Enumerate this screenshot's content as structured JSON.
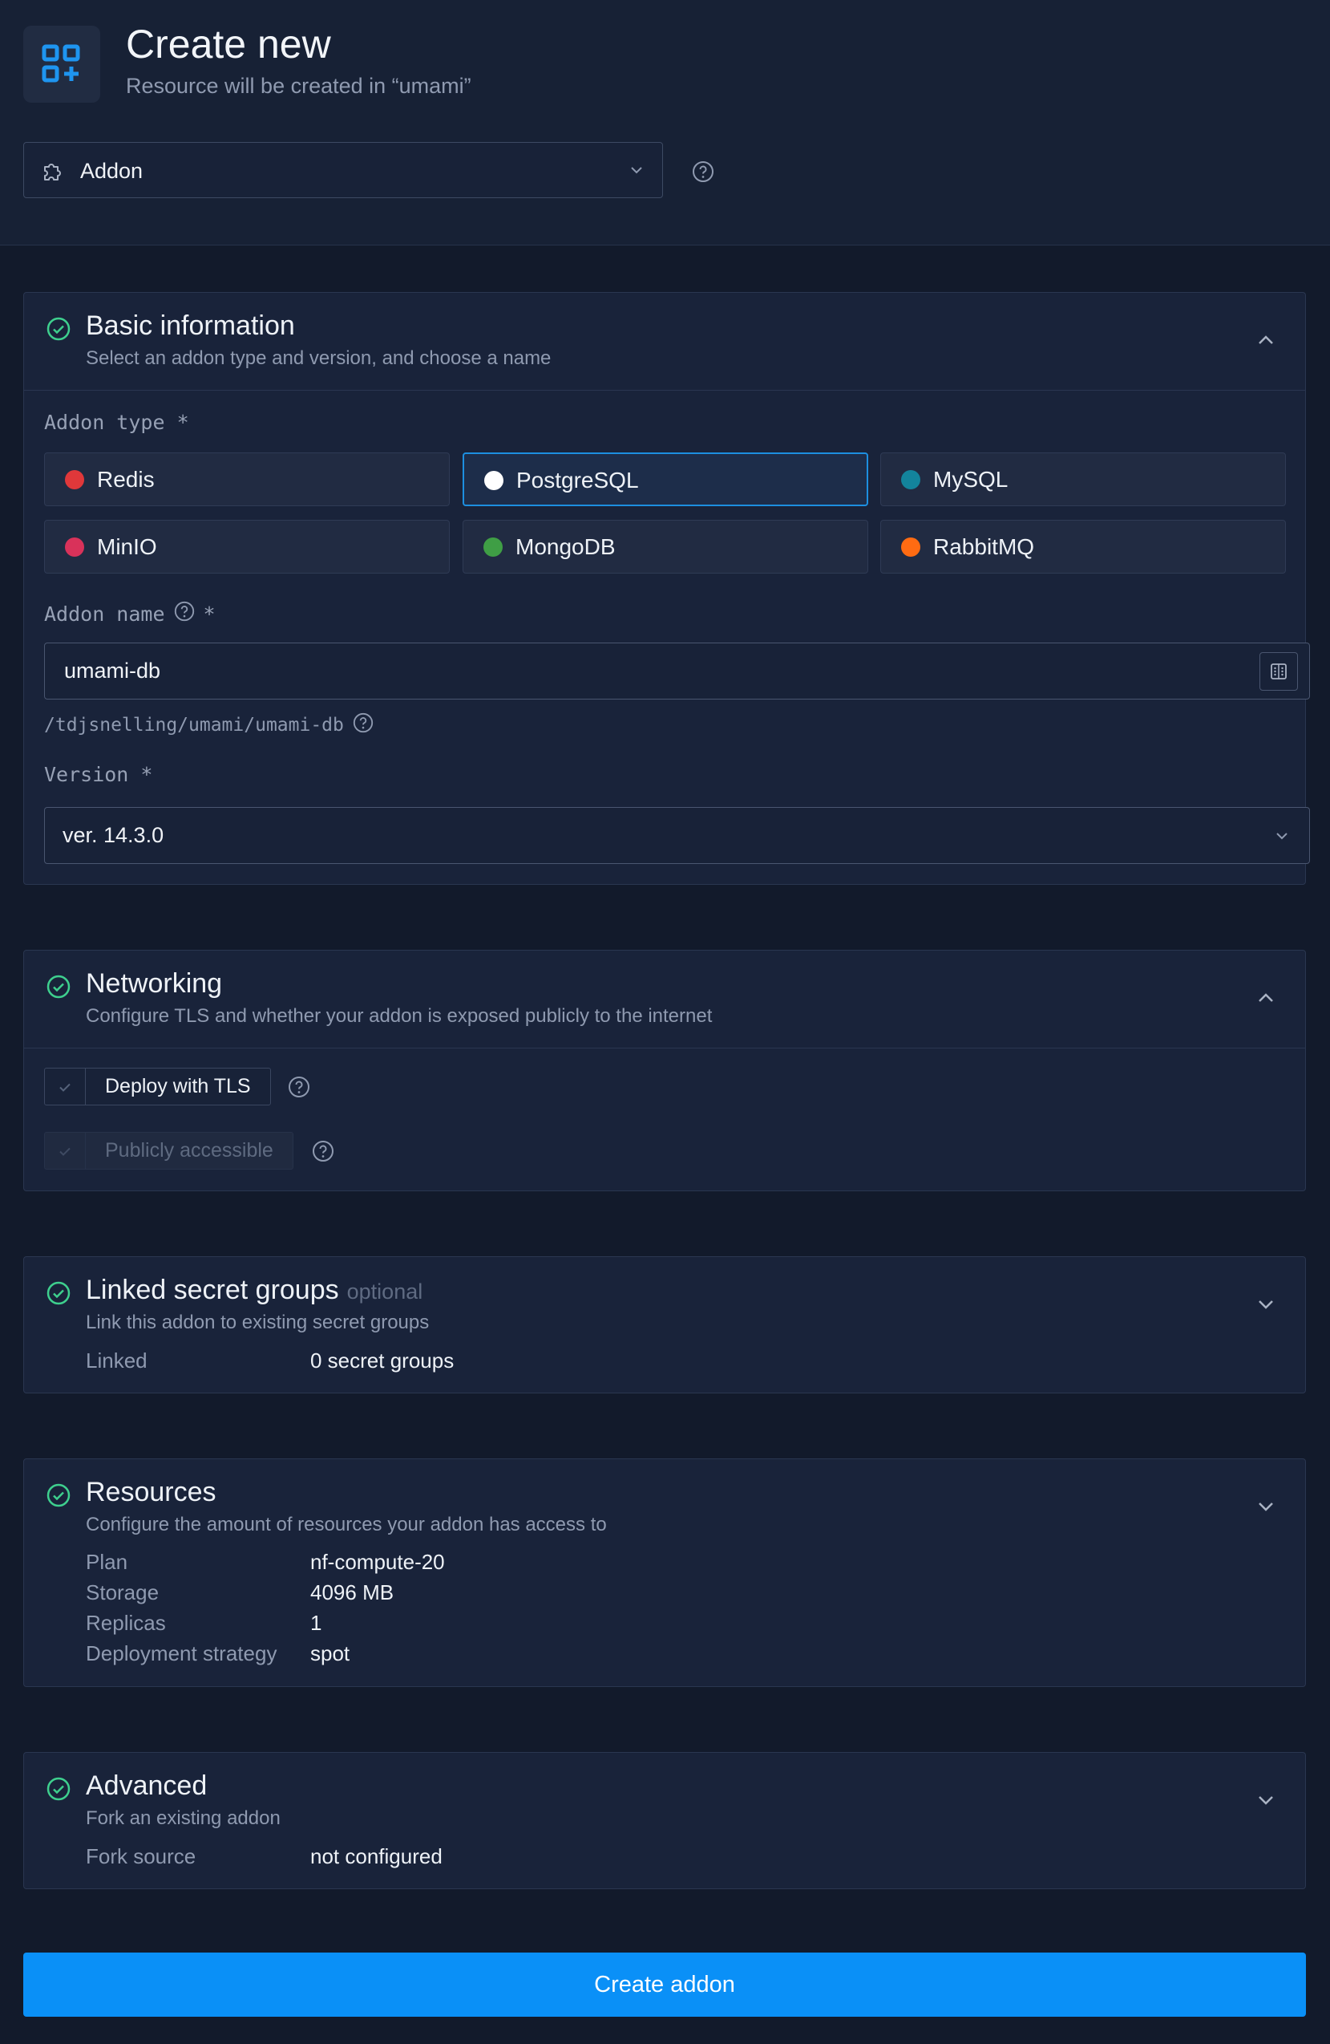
{
  "header": {
    "title": "Create new",
    "subtitle": "Resource will be created in “umami”",
    "icon": "add-grid-icon",
    "resource_type": {
      "label": "Addon",
      "icon": "puzzle-icon"
    }
  },
  "colors": {
    "accent": "#0a90f7",
    "success": "#3ecf8e",
    "background": "#121a2b",
    "panel": "#19233a"
  },
  "basic": {
    "title": "Basic information",
    "description": "Select an addon type and version, and choose a name",
    "addon_type_label": "Addon type *",
    "types": [
      {
        "name": "Redis",
        "color": "#e0383a",
        "selected": false
      },
      {
        "name": "PostgreSQL",
        "color": "#ffffff",
        "selected": true
      },
      {
        "name": "MySQL",
        "color": "#13849c",
        "selected": false
      },
      {
        "name": "MinIO",
        "color": "#d9325a",
        "selected": false
      },
      {
        "name": "MongoDB",
        "color": "#3f9e45",
        "selected": false
      },
      {
        "name": "RabbitMQ",
        "color": "#ff6b12",
        "selected": false
      }
    ],
    "name_label": "Addon name",
    "name_required": "*",
    "name_value": "umami-db",
    "path": "/tdjsnelling/umami/umami-db",
    "version_label": "Version *",
    "version_value": "ver. 14.3.0"
  },
  "networking": {
    "title": "Networking",
    "description": "Configure TLS and whether your addon is exposed publicly to the internet",
    "tls_label": "Deploy with TLS",
    "public_label": "Publicly accessible"
  },
  "secrets": {
    "title": "Linked secret groups",
    "optional": "optional",
    "description": "Link this addon to existing secret groups",
    "linked_key": "Linked",
    "linked_value": "0 secret groups"
  },
  "resources": {
    "title": "Resources",
    "description": "Configure the amount of resources your addon has access to",
    "rows": [
      {
        "key": "Plan",
        "value": "nf-compute-20"
      },
      {
        "key": "Storage",
        "value": "4096 MB"
      },
      {
        "key": "Replicas",
        "value": "1"
      },
      {
        "key": "Deployment strategy",
        "value": "spot"
      }
    ]
  },
  "advanced": {
    "title": "Advanced",
    "description": "Fork an existing addon",
    "fork_key": "Fork source",
    "fork_value": "not configured"
  },
  "submit_label": "Create addon"
}
